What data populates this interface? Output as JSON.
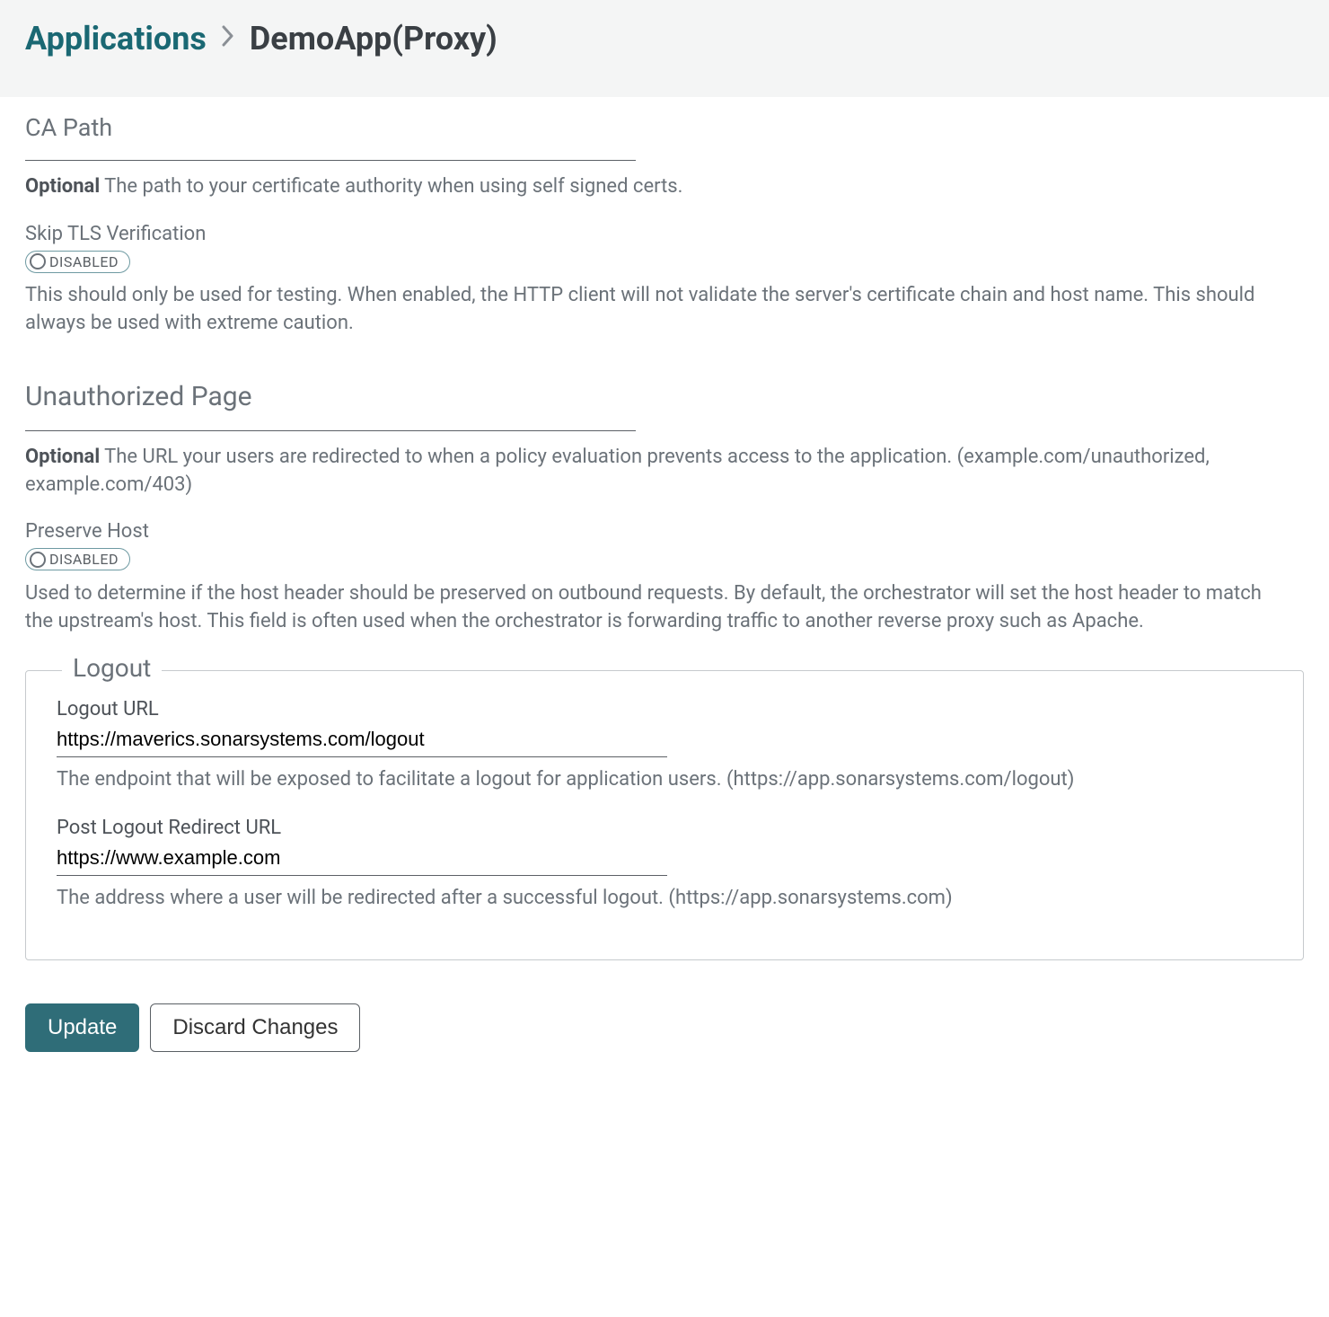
{
  "breadcrumb": {
    "root": "Applications",
    "current": "DemoApp(Proxy)"
  },
  "ca_path": {
    "label": "CA Path",
    "helper_prefix": "Optional",
    "helper": " The path to your certificate authority when using self signed certs."
  },
  "skip_tls": {
    "label": "Skip TLS Verification",
    "state": "DISABLED",
    "helper": "This should only be used for testing. When enabled, the HTTP client will not validate the server's certificate chain and host name. This should always be used with extreme caution."
  },
  "unauthorized": {
    "label": "Unauthorized Page",
    "helper_prefix": "Optional",
    "helper": " The URL your users are redirected to when a policy evaluation prevents access to the application. (example.com/unauthorized, example.com/403)"
  },
  "preserve_host": {
    "label": "Preserve Host",
    "state": "DISABLED",
    "helper": "Used to determine if the host header should be preserved on outbound requests. By default, the orchestrator will set the host header to match the upstream's host. This field is often used when the orchestrator is forwarding traffic to another reverse proxy such as Apache."
  },
  "logout": {
    "legend": "Logout",
    "url_label": "Logout URL",
    "url_value": "https://maverics.sonarsystems.com/logout",
    "url_helper": "The endpoint that will be exposed to facilitate a logout for application users. (https://app.sonarsystems.com/logout)",
    "post_label": "Post Logout Redirect URL",
    "post_value": "https://www.example.com",
    "post_helper": "The address where a user will be redirected after a successful logout. (https://app.sonarsystems.com)"
  },
  "buttons": {
    "update": "Update",
    "discard": "Discard Changes"
  }
}
